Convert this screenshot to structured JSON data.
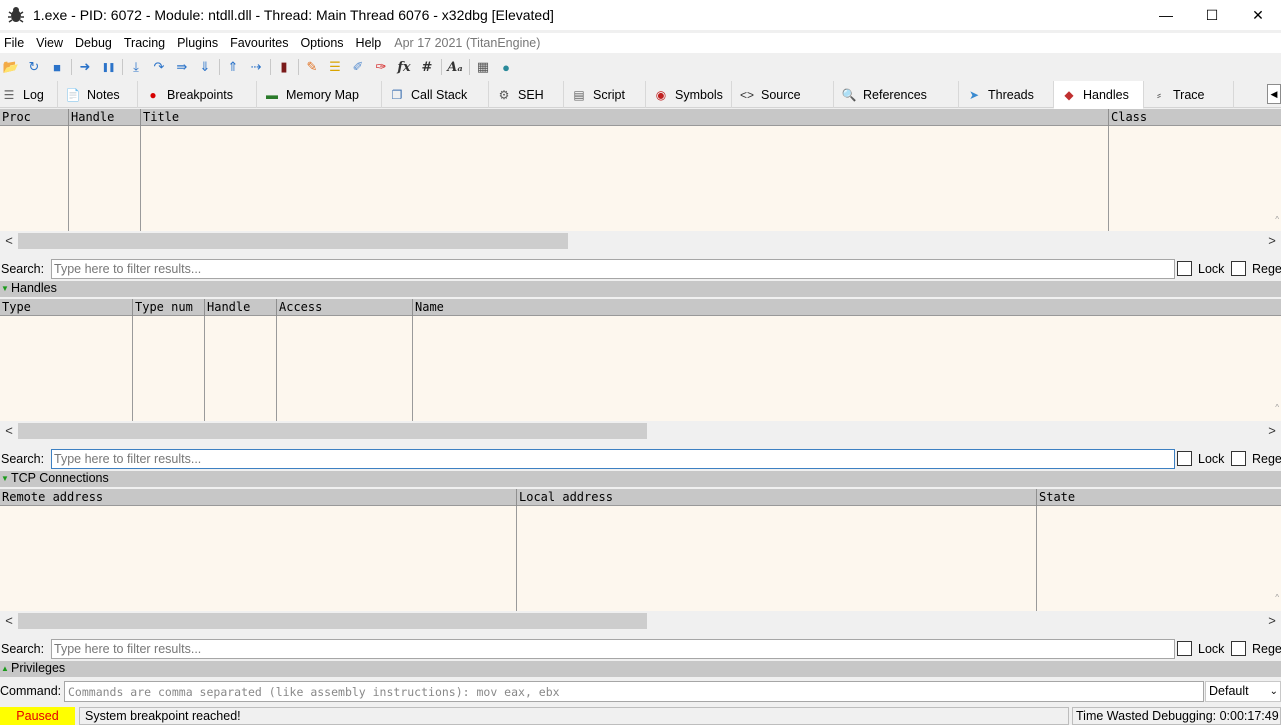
{
  "window": {
    "title": "1.exe - PID: 6072 - Module: ntdll.dll - Thread: Main Thread 6076 - x32dbg [Elevated]",
    "app_icon": "bug-icon",
    "controls": {
      "minimize": "—",
      "maximize": "☐",
      "close": "✕"
    }
  },
  "menu": {
    "items": [
      "File",
      "View",
      "Debug",
      "Tracing",
      "Plugins",
      "Favourites",
      "Options",
      "Help"
    ],
    "build_date": "Apr 17 2021 (TitanEngine)"
  },
  "toolbar": {
    "buttons": [
      {
        "icon": "open-folder-icon",
        "glyph": "📂",
        "color": "#d9a400"
      },
      {
        "icon": "restart-icon",
        "glyph": "↻",
        "color": "#2b73c9"
      },
      {
        "icon": "stop-icon",
        "glyph": "■",
        "color": "#2b73c9"
      },
      {
        "icon": "run-icon",
        "glyph": "➜",
        "color": "#2b73c9"
      },
      {
        "icon": "pause-icon",
        "glyph": "❚❚",
        "color": "#2b73c9"
      },
      {
        "icon": "step-into-icon",
        "glyph": "⤓",
        "color": "#2b73c9"
      },
      {
        "icon": "step-over-icon",
        "glyph": "↷",
        "color": "#2b73c9"
      },
      {
        "icon": "trace-into-icon",
        "glyph": "⇛",
        "color": "#2b73c9"
      },
      {
        "icon": "trace-over-icon",
        "glyph": "⇓",
        "color": "#2b73c9"
      },
      {
        "icon": "execute-till-return-icon",
        "glyph": "⇑",
        "color": "#2b73c9"
      },
      {
        "icon": "run-to-user-code-icon",
        "glyph": "⇢",
        "color": "#2b73c9"
      },
      {
        "icon": "scylla-icon",
        "glyph": "▮",
        "color": "#7a1a1a"
      },
      {
        "icon": "patch-icon",
        "glyph": "✎",
        "color": "#e07020"
      },
      {
        "icon": "comments-icon",
        "glyph": "☰",
        "color": "#d9a400"
      },
      {
        "icon": "labels-icon",
        "glyph": "✐",
        "color": "#5a8fd0"
      },
      {
        "icon": "bookmarks-icon",
        "glyph": "✑",
        "color": "#d42020"
      },
      {
        "icon": "functions-icon",
        "glyph": "fx",
        "color": "#333333"
      },
      {
        "icon": "hash-icon",
        "glyph": "#",
        "color": "#333333"
      },
      {
        "icon": "font-size-icon",
        "glyph": "Aₐ",
        "color": "#333333"
      },
      {
        "icon": "calculator-icon",
        "glyph": "▦",
        "color": "#555555"
      },
      {
        "icon": "globe-icon",
        "glyph": "●",
        "color": "#2a8a9a"
      }
    ]
  },
  "tabs": [
    {
      "label": "Log",
      "icon": "log-icon",
      "glyph": "☰",
      "color": "#666666"
    },
    {
      "label": "Notes",
      "icon": "notes-icon",
      "glyph": "📄",
      "color": "#666666"
    },
    {
      "label": "Breakpoints",
      "icon": "breakpoint-icon",
      "glyph": "●",
      "color": "#d60000"
    },
    {
      "label": "Memory Map",
      "icon": "memory-map-icon",
      "glyph": "▬",
      "color": "#2a7a2a"
    },
    {
      "label": "Call Stack",
      "icon": "call-stack-icon",
      "glyph": "❐",
      "color": "#3a6fb0"
    },
    {
      "label": "SEH",
      "icon": "seh-icon",
      "glyph": "⚙",
      "color": "#555555"
    },
    {
      "label": "Script",
      "icon": "script-icon",
      "glyph": "▤",
      "color": "#666666"
    },
    {
      "label": "Symbols",
      "icon": "symbols-icon",
      "glyph": "◉",
      "color": "#c02020"
    },
    {
      "label": "Source",
      "icon": "source-icon",
      "glyph": "<>",
      "color": "#333333"
    },
    {
      "label": "References",
      "icon": "references-icon",
      "glyph": "🔍",
      "color": "#666666"
    },
    {
      "label": "Threads",
      "icon": "threads-icon",
      "glyph": "➤",
      "color": "#3a8ad0"
    },
    {
      "label": "Handles",
      "icon": "handles-icon",
      "glyph": "◆",
      "color": "#c03030"
    },
    {
      "label": "Trace",
      "icon": "trace-icon",
      "glyph": "⸗",
      "color": "#555555"
    }
  ],
  "tab_scroll_glyph": "◀",
  "active_tab": "Handles",
  "windows_table": {
    "columns": [
      "Proc",
      "Handle",
      "Title",
      "Class"
    ]
  },
  "handles_section": {
    "label": "Handles"
  },
  "handles_table": {
    "columns": [
      "Type",
      "Type num",
      "Handle",
      "Access",
      "Name"
    ]
  },
  "tcp_section": {
    "label": "TCP Connections"
  },
  "tcp_table": {
    "columns": [
      "Remote address",
      "Local address",
      "State"
    ]
  },
  "privileges_section": {
    "label": "Privileges"
  },
  "search": {
    "label": "Search:",
    "placeholder": "Type here to filter results...",
    "lock_label": "Lock",
    "regex_label": "Regex"
  },
  "scroll": {
    "left": "<",
    "right": ">",
    "up": "^"
  },
  "section_glyph_open": "▼",
  "section_glyph_closed": "▲",
  "command": {
    "label": "Command:",
    "placeholder": "Commands are comma separated (like assembly instructions): mov eax, ebx",
    "mode": "Default",
    "mode_chevron": "⌄"
  },
  "status": {
    "state": "Paused",
    "message": "System breakpoint reached!",
    "time": "Time Wasted Debugging: 0:00:17:49"
  },
  "colors": {
    "table_bg": "#fdf7ee",
    "header_bg": "#c7c7c7",
    "paused_bg": "#ffff00",
    "paused_fg": "#e60000"
  }
}
